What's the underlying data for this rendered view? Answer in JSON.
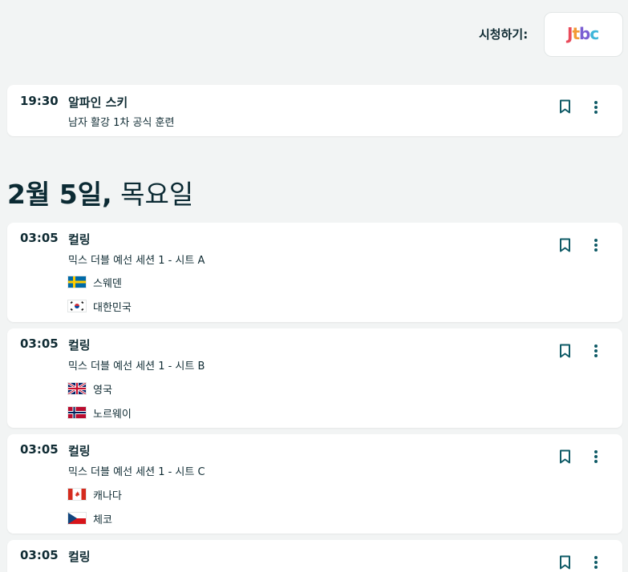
{
  "watch": {
    "label": "시청하기:",
    "provider": "jtbc"
  },
  "top_event": {
    "time": "19:30",
    "sport": "알파인 스키",
    "description": "남자 활강 1차 공식 훈련"
  },
  "date_heading": {
    "date": "2월 5일,",
    "weekday": "목요일"
  },
  "events": [
    {
      "time": "03:05",
      "sport": "컬링",
      "description": "믹스 더블 예선 세션 1 - 시트 A",
      "teams": [
        {
          "name": "스웨덴",
          "flag": "sweden-flag"
        },
        {
          "name": "대한민국",
          "flag": "korea-flag"
        }
      ]
    },
    {
      "time": "03:05",
      "sport": "컬링",
      "description": "믹스 더블 예선 세션 1 - 시트 B",
      "teams": [
        {
          "name": "영국",
          "flag": "uk-flag"
        },
        {
          "name": "노르웨이",
          "flag": "norway-flag"
        }
      ]
    },
    {
      "time": "03:05",
      "sport": "컬링",
      "description": "믹스 더블 예선 세션 1 - 시트 C",
      "teams": [
        {
          "name": "캐나다",
          "flag": "canada-flag"
        },
        {
          "name": "체코",
          "flag": "czech-flag"
        }
      ]
    },
    {
      "time": "03:05",
      "sport": "컬링",
      "description": ""
    }
  ],
  "colors": {
    "background": "#f2f4f4",
    "text": "#0f2b33",
    "icon": "#0e5a66"
  }
}
